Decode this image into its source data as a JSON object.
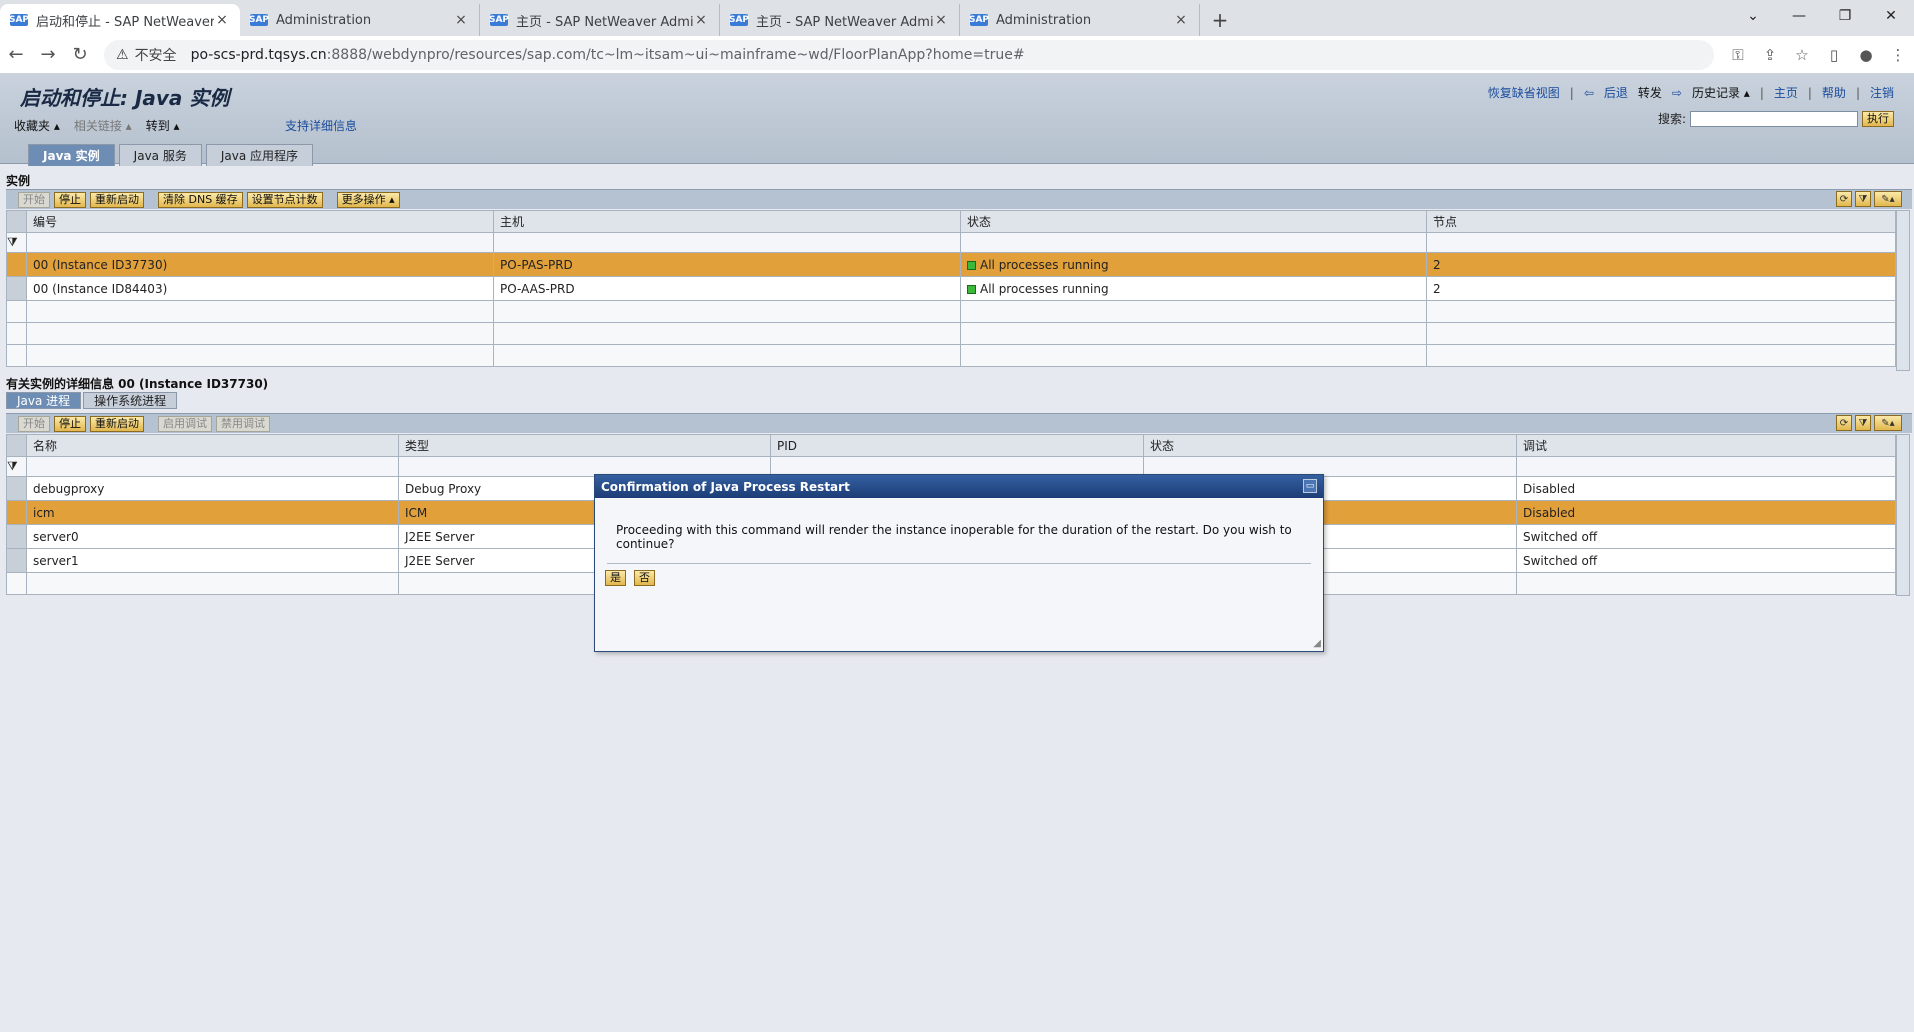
{
  "browser": {
    "tabs": [
      {
        "title": "启动和停止 - SAP NetWeaver A",
        "active": true
      },
      {
        "title": "Administration",
        "active": false
      },
      {
        "title": "主页 - SAP NetWeaver Admini",
        "active": false
      },
      {
        "title": "主页 - SAP NetWeaver Admini",
        "active": false
      },
      {
        "title": "Administration",
        "active": false
      }
    ],
    "favicon_text": "SAP",
    "new_tab": "+",
    "close_glyph": "×",
    "insecure_label": "不安全",
    "url_host": "po-scs-prd.tqsys.cn",
    "url_path": ":8888/webdynpro/resources/sap.com/tc~lm~itsam~ui~mainframe~wd/FloorPlanApp?home=true#"
  },
  "sap": {
    "title": "启动和停止: Java 实例",
    "menus": {
      "favorites": "收藏夹 ▴",
      "related": "相关链接 ▴",
      "goto": "转到 ▴"
    },
    "support_link": "支持详细信息",
    "toplinks": {
      "restore": "恢复缺省视图",
      "back": "后退",
      "forward": "转发",
      "history": "历史记录 ▴",
      "home": "主页",
      "help": "帮助",
      "logout": "注销"
    },
    "search_label": "搜索:",
    "execute": "执行",
    "main_tabs": [
      "Java 实例",
      "Java 服务",
      "Java 应用程序"
    ],
    "instances": {
      "title": "实例",
      "toolbar": {
        "start": "开始",
        "stop": "停止",
        "restart": "重新启动",
        "clear_dns": "清除 DNS 缓存",
        "set_node_count": "设置节点计数",
        "more": "更多操作 ▴"
      },
      "columns": [
        "编号",
        "主机",
        "状态",
        "节点"
      ],
      "rows": [
        {
          "id": "00 (Instance ID37730)",
          "host": "PO-PAS-PRD",
          "status": "All processes running",
          "nodes": "2"
        },
        {
          "id": "00 (Instance ID84403)",
          "host": "PO-AAS-PRD",
          "status": "All processes running",
          "nodes": "2"
        }
      ]
    },
    "details": {
      "title": "有关实例的详细信息 00 (Instance ID37730)",
      "tabs": [
        "Java 进程",
        "操作系统进程"
      ],
      "toolbar": {
        "start": "开始",
        "stop": "停止",
        "restart": "重新启动",
        "enable_debug": "启用调试",
        "disable_debug": "禁用调试"
      },
      "columns": [
        "名称",
        "类型",
        "PID",
        "状态",
        "调试"
      ],
      "rows": [
        {
          "name": "debugproxy",
          "type": "Debug Proxy",
          "debug": "Disabled"
        },
        {
          "name": "icm",
          "type": "ICM",
          "debug": "Disabled"
        },
        {
          "name": "server0",
          "type": "J2EE Server",
          "debug": "Switched off"
        },
        {
          "name": "server1",
          "type": "J2EE Server",
          "debug": "Switched off"
        }
      ]
    }
  },
  "dialog": {
    "title": "Confirmation of Java Process Restart",
    "message": "Proceeding with this command will render the instance inoperable for the duration of the restart. Do you wish to continue?",
    "yes": "是",
    "no": "否"
  }
}
